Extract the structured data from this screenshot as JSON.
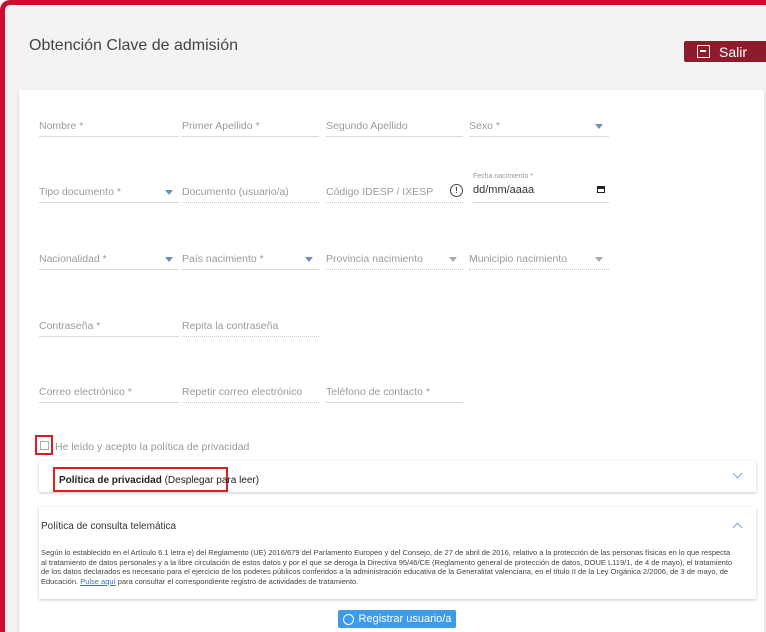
{
  "header": {
    "title": "Obtención Clave de admisión",
    "salir_label": "Salir"
  },
  "form": {
    "row1": {
      "nombre": "Nombre *",
      "primer_apellido": "Primer Apellido *",
      "segundo_apellido": "Segundo Apellido",
      "sexo": "Sexo *"
    },
    "row2": {
      "tipo_documento": "Tipo documento *",
      "documento": "Documento (usuario/a)",
      "codigo": "Código IDESP / IXESP",
      "fecha_label": "Fecha nacimiento *",
      "fecha_value": "dd/mm/aaaa"
    },
    "row3": {
      "nacionalidad": "Nacionalidad *",
      "pais": "País nacimiento *",
      "provincia": "Provincia nacimiento",
      "municipio": "Municipio nacimiento"
    },
    "row4": {
      "contrasena": "Contraseña *",
      "repita": "Repita la contraseña"
    },
    "row5": {
      "correo": "Correo electrónico *",
      "repetir_correo": "Repetir correo electrónico",
      "telefono": "Teléfono de contacto *"
    },
    "privacy_check_label": "He leído y acepto la política de privacidad"
  },
  "panels": {
    "privacidad_title": "Política de privacidad",
    "privacidad_hint": "(Desplegar para leer)",
    "consulta_title": "Política de consulta telemática",
    "consulta_text_1": "Según lo establecido en el Artículo 6.1 letra e) del Reglamento (UE) 2016/679 del Parlamento Europeo y del Consejo, de 27 de abril de 2016, relativo a la protección de las personas físicas en lo que respecta al tratamiento de datos personales y a la libre circulación de estos datos y por el que se deroga la Directiva 95/46/CE (Reglamento general de protección de datos, DOUE L119/1, de 4 de mayo), el tratamiento de los datos declarados es necesario para el ejercicio de los poderes públicos conferidos a la administración educativa de la Generalitat valenciana, en el título II de la Ley Orgánica 2/2006, de 3 de mayo, de Educación.",
    "consulta_link": "Pulse aquí",
    "consulta_text_2": "para consultar el correspondiente registro de actividades de tratamiento."
  },
  "register_button": "Registrar usuario/a",
  "colors": {
    "accent_red": "#c8102e",
    "salir_bg": "#8c1c2c",
    "button_blue": "#3d9be9"
  }
}
